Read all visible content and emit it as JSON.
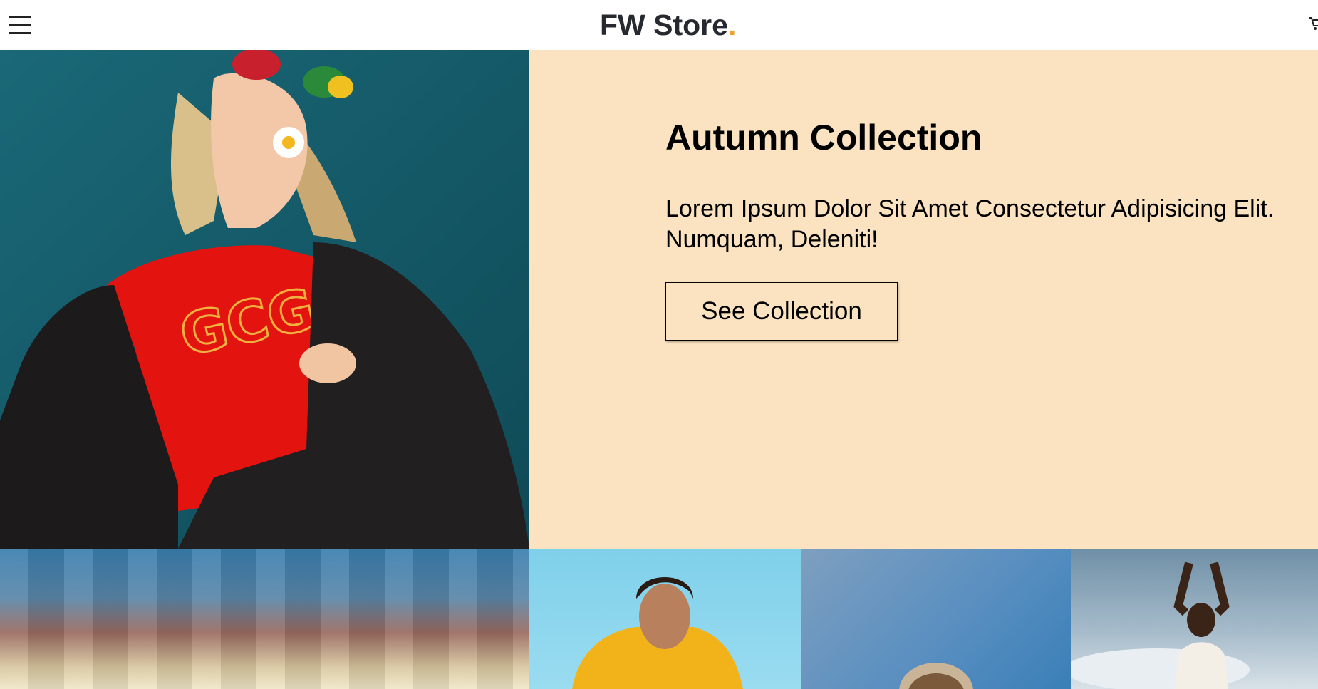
{
  "header": {
    "brand": "FW Store",
    "brand_dot": ".",
    "menu_icon": "hamburger-menu-icon",
    "cart_icon": "shopping-cart-icon"
  },
  "hero": {
    "title": "Autumn Collection",
    "text": "Lorem Ipsum Dolor Sit Amet Consectetur Adipisicing Elit. Numquam, Deleniti!",
    "button_label": "See Collection"
  },
  "colors": {
    "hero_panel": "#fbe3c1",
    "brand_text": "#26292f",
    "brand_accent": "#f0a030"
  }
}
